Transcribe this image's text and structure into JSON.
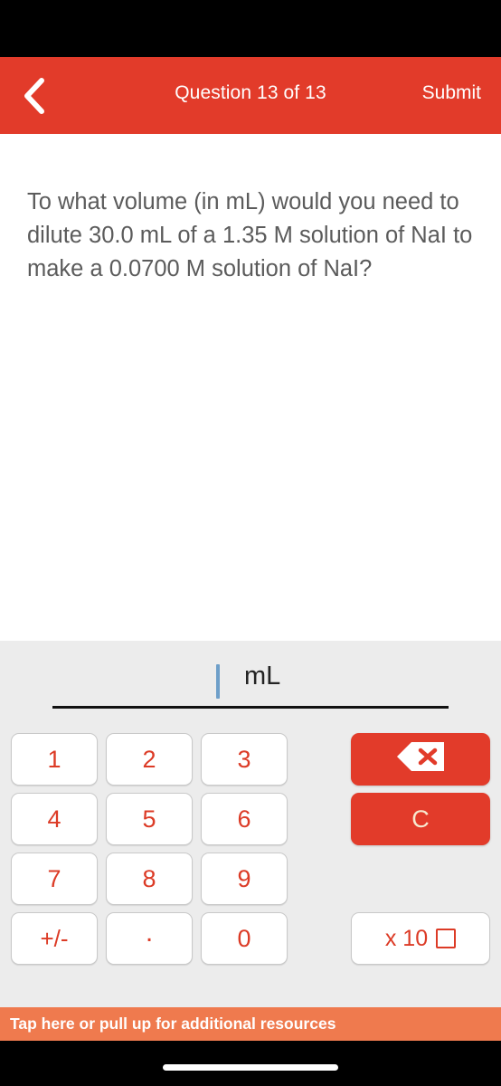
{
  "header": {
    "back_icon": "chevron-left-icon",
    "title": "Question 13 of 13",
    "submit_label": "Submit",
    "background_color": "#e23b2a",
    "text_color": "#ffffff"
  },
  "question": {
    "text": "To what volume (in mL) would you need to dilute 30.0 mL of a 1.35 M solution of NaI to make a 0.0700 M solution of NaI?",
    "text_color": "#5b5b5b"
  },
  "answer": {
    "value": "",
    "unit": "mL",
    "caret_color": "#6e9fc9",
    "underline_color": "#111111"
  },
  "keypad": {
    "background_color": "#ececec",
    "digit_color": "#dc3b26",
    "rows": [
      [
        "1",
        "2",
        "3"
      ],
      [
        "4",
        "5",
        "6"
      ],
      [
        "7",
        "8",
        "9"
      ],
      [
        "+/-",
        ".",
        "0"
      ]
    ],
    "actions": {
      "backspace_icon": "backspace-delete-icon",
      "clear_label": "C",
      "scientific_label": "x 10",
      "scientific_exponent_placeholder": "",
      "action_background_color": "#e23b2a"
    }
  },
  "footer": {
    "resources_text": "Tap here or pull up for additional resources",
    "background_color": "#ef7a4e"
  }
}
